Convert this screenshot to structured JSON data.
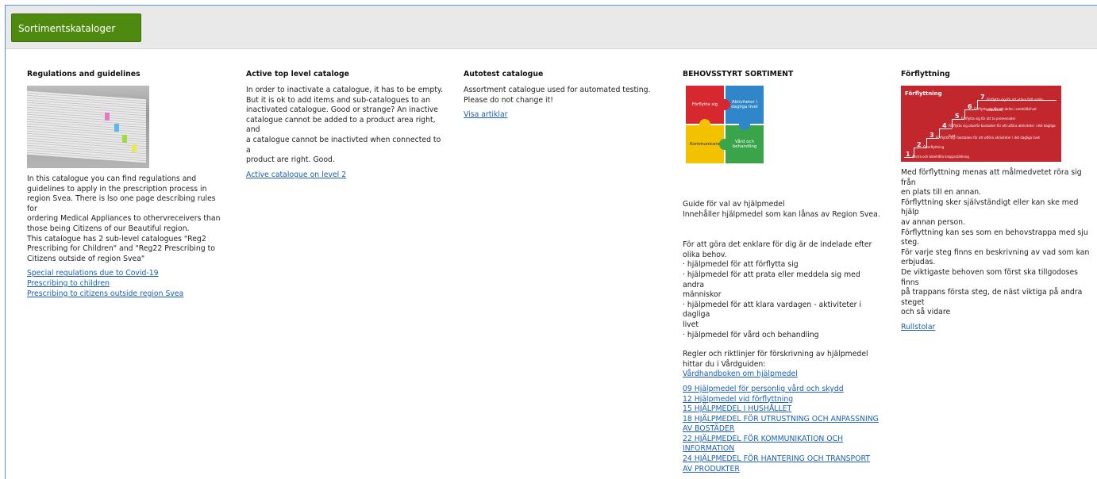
{
  "header": {
    "tab_label": "Sortimentskataloger"
  },
  "columns": [
    {
      "title": "Regulations and guidelines",
      "image": "book-stack-image",
      "lines": [
        "In this catalogue you can find regulations and",
        "guidelines to apply in the prescription process in",
        "region Svea. There is lso one page describing rules for",
        "ordering Medical Appliances to othervreceivers than",
        "those being Citizens of our Beautiful region.",
        "This catalogue has 2 sub-level catalogues \"Reg2",
        "Prescribing for Children\" and \"Reg22 Prescribing to",
        "Citizens outside of region Svea\""
      ],
      "links": [
        "Special regulations due to Covid-19",
        "Prescribing to children",
        "Prescribing to citizens outside region Svea"
      ]
    },
    {
      "title": "Active top level cataloge",
      "lines": [
        "In order to inactivate a catalogue, it has to be empty.",
        "But it is ok to add items and sub-catalogues to an",
        "inactivated catalogue. Good or strange? An inactive",
        "catalogue cannot be added to a product area right, and",
        "a catalogue cannot be inactivted when connected to a",
        "product are right. Good."
      ],
      "links": [
        "Active catalogue on level 2"
      ]
    },
    {
      "title": "Autotest catalogue",
      "lines": [
        "Assortment catalogue used for automated testing.",
        "Please do not change it!"
      ],
      "links": [
        "Visa artiklar"
      ]
    },
    {
      "title": "BEHOVSSTYRT SORTIMENT",
      "puzzle": {
        "red": "Förflytta sig",
        "blue": "Aktiviteter i dagliga livet",
        "yellow": "Kommunicera",
        "green": "Vård och behandling"
      },
      "intro": [
        "Guide för val av hjälpmedel",
        "Innehåller hjälpmedel som kan lånas av Region Svea."
      ],
      "lines": [
        "För att göra det enklare för dig är de indelade efter",
        "olika behov.",
        "· hjälpmedel för att förflytta sig",
        "· hjälpmedel för att prata eller meddela sig med andra",
        "människor",
        "· hjälpmedel för att klara vardagen - aktiviteter i dagliga",
        "livet",
        "· hjälpmedel för vård och behandling"
      ],
      "lines2": [
        "Regler och riktlinjer för förskrivning av hjälpmedel",
        "hittar du i Vårdguiden:"
      ],
      "guide_link": "Vårdhandboken om hjälpmedel",
      "links": [
        "09 Hjälpmedel för personlig vård och skydd",
        "12 Hjälpmedel vid förflyttning",
        "15 HJÄLPMEDEL I HUSHÅLLET",
        "18 HJÄLPMEDEL FÖR UTRUSTNING OCH ANPASSNING AV BOSTÄDER",
        "22 HJÄLPMEDEL FÖR KOMMUNIKATION OCH INFORMATION",
        "24 HJÄLPMEDEL FÖR HANTERING OCH TRANSPORT AV PRODUKTER"
      ]
    },
    {
      "title": "Förflyttning",
      "stairs": {
        "title": "Förflyttning",
        "steps": [
          {
            "n": "1",
            "t": "Ändra och bibehålla kroppsställning"
          },
          {
            "n": "2",
            "t": "Överflyttning"
          },
          {
            "n": "3",
            "t": "Förflytta sig i bostaden för att utföra aktiviteter i det dagliga livet"
          },
          {
            "n": "4",
            "t": "Förflytta sig utanför bostaden för att utföra aktiviteter i det dagliga livet"
          },
          {
            "n": "5",
            "t": "Förflytta sig för att ta promenader"
          },
          {
            "n": "6",
            "t": "Förflytta sig för att delta i samhällslivet"
          },
          {
            "n": "7",
            "t": "Förflytta sig för att utöva fritt valda aktiviteter"
          }
        ]
      },
      "lines": [
        "Med förflyttning menas att målmedvetet röra sig från",
        "en plats till en annan.",
        "Förflyttning sker självständigt eller kan ske med hjälp",
        "av annan person.",
        "Förflyttning kan ses som en behovstrappa med sju",
        "steg.",
        "För varje steg finns en beskrivning av vad som kan",
        "erbjudas.",
        "De viktigaste behoven som först ska tillgodoses finns",
        "på trappans första steg, de näst viktiga på andra steget",
        "och så vidare"
      ],
      "links": [
        "Rullstolar"
      ]
    }
  ]
}
